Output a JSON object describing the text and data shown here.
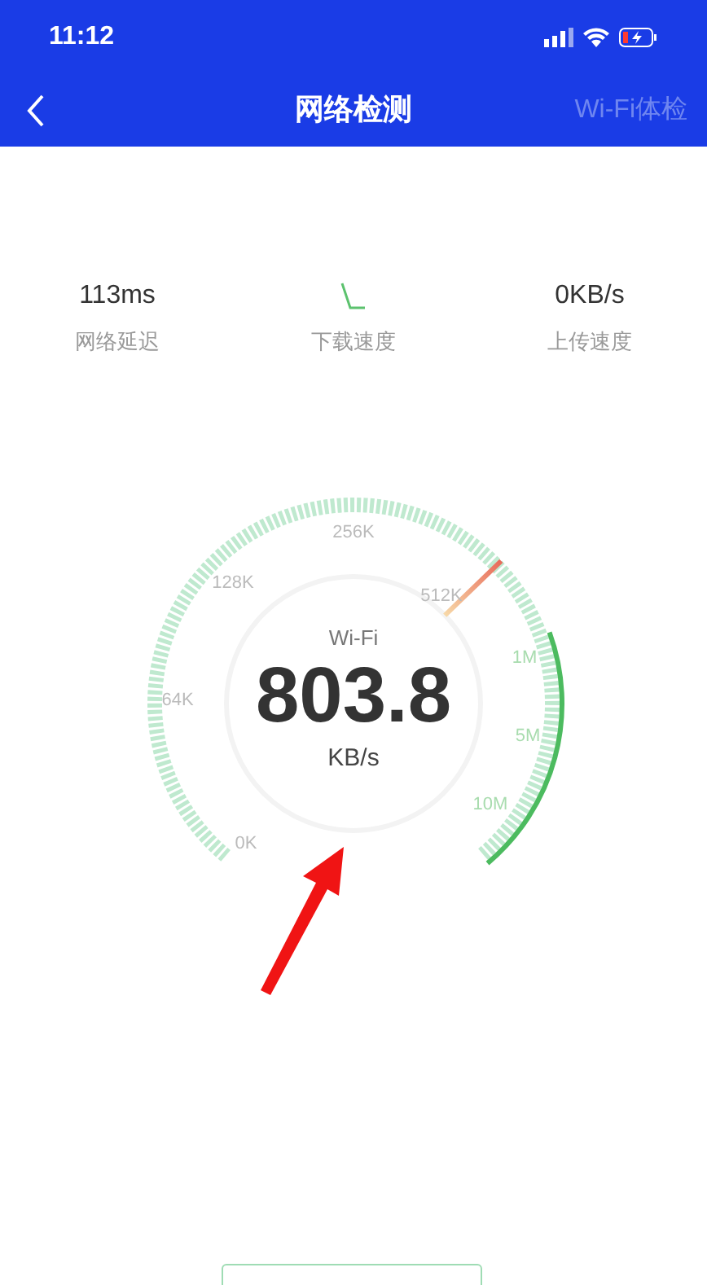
{
  "status_bar": {
    "time": "11:12"
  },
  "nav": {
    "title": "网络检测",
    "action": "Wi-Fi体检"
  },
  "stats": [
    {
      "kind": "text",
      "value": "113ms",
      "label": "网络延迟"
    },
    {
      "kind": "graph",
      "label": "下载速度"
    },
    {
      "kind": "text",
      "value": "0KB/s",
      "label": "上传速度"
    }
  ],
  "gauge": {
    "network": "Wi-Fi",
    "reading": "803.8",
    "unit": "KB/s",
    "scale": [
      {
        "label": "0K",
        "highlighted": false
      },
      {
        "label": "64K",
        "highlighted": false
      },
      {
        "label": "128K",
        "highlighted": false
      },
      {
        "label": "256K",
        "highlighted": false
      },
      {
        "label": "512K",
        "highlighted": false
      },
      {
        "label": "1M",
        "highlighted": true
      },
      {
        "label": "5M",
        "highlighted": true
      },
      {
        "label": "10M",
        "highlighted": true
      }
    ]
  }
}
